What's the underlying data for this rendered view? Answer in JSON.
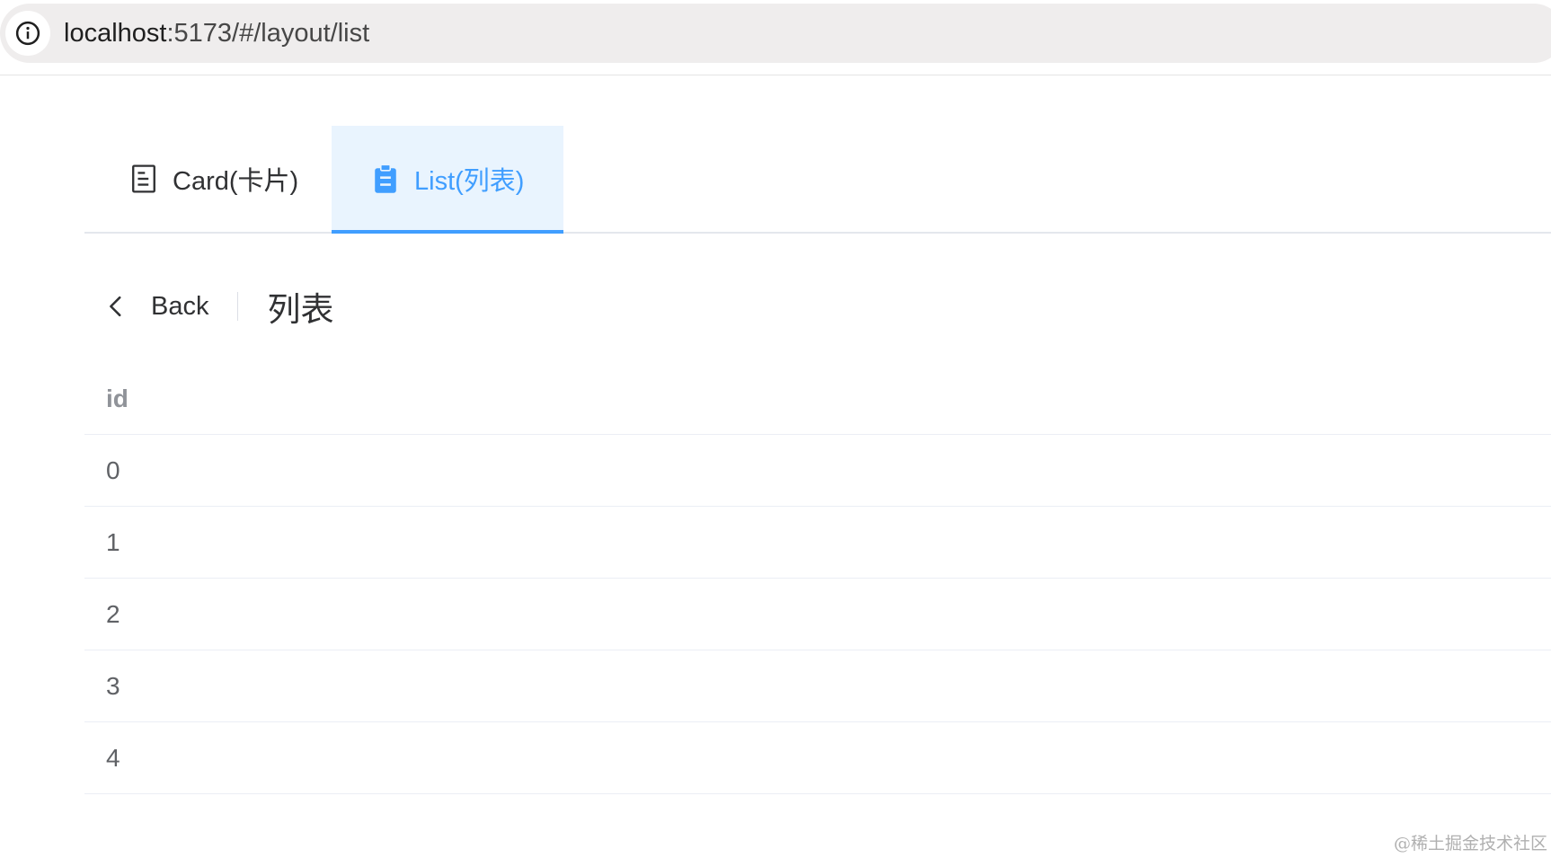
{
  "browser": {
    "url_host": "localhost",
    "url_path": ":5173/#/layout/list"
  },
  "tabs": [
    {
      "label": "Card(卡片)",
      "icon": "document-icon",
      "active": false
    },
    {
      "label": "List(列表)",
      "icon": "clipboard-icon",
      "active": true
    }
  ],
  "page_header": {
    "back_label": "Back",
    "title": "列表"
  },
  "table": {
    "columns": [
      "id"
    ],
    "rows": [
      "0",
      "1",
      "2",
      "3",
      "4"
    ]
  },
  "watermark": "@稀土掘金技术社区",
  "colors": {
    "accent": "#409eff",
    "active_tab_bg": "#e9f4fe",
    "header_text": "#909399",
    "cell_text": "#606266"
  }
}
